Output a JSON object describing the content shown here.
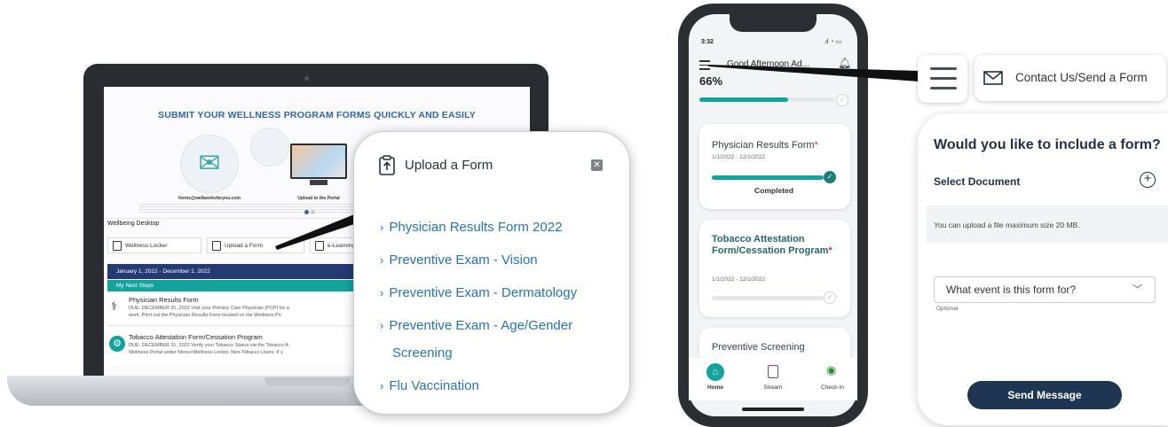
{
  "laptop": {
    "banner_title": "SUBMIT YOUR WELLNESS PROGRAM FORMS QUICKLY AND EASILY",
    "email_label": "forms@wellworksforyou.com",
    "portal_label": "Upload to the Portal",
    "wellbeing_desktop": "Wellbeing Desktop",
    "tools": [
      {
        "label": "Wellness Locker"
      },
      {
        "label": "Upload a Form"
      },
      {
        "label": "e-Learning"
      }
    ],
    "date_range": "January 1, 2022 - December 1, 2022",
    "next_steps": "My Next Steps",
    "steps": [
      {
        "title": "Physician Results Form",
        "desc1": "DUE: DECEMBER 31, 2022 Visit your Primary Care Physician (PCP) for a",
        "desc2": "work. Print out the Physician Results Form located on the Wellness Po"
      },
      {
        "title": "Tobacco Attestation Form/Cessation Program",
        "desc1": "DUE: DECEMBER 31, 2022 Verify your Tobacco Status via the Tobacco A",
        "desc2": "Wellness Portal under Menu>Wellness Locker.  Non-Tobacco Users: If y"
      }
    ]
  },
  "upload_popup": {
    "title": "Upload a Form",
    "close": "✕",
    "links": [
      "Physician Results Form 2022",
      "Preventive Exam - Vision",
      "Preventive Exam - Dermatology",
      "Preventive Exam - Age/Gender",
      "Screening",
      "Flu Vaccination"
    ]
  },
  "phone": {
    "time": "3:32",
    "greeting": "Good Afternoon Ad...",
    "progress_text": "66%",
    "progress": 0.66,
    "cards": [
      {
        "title": "Physician Results Form",
        "dates": "1/1/2022 - 12/1/2022",
        "status": "Completed"
      },
      {
        "title": "Tobacco Attestation Form/Cessation Program",
        "dates": "1/1/2022 - 12/1/2022"
      },
      {
        "title": "Preventive Screening"
      }
    ],
    "nav": [
      "Home",
      "Stream",
      "Check-In"
    ]
  },
  "contact": {
    "label": "Contact Us/Send a Form"
  },
  "form_panel": {
    "title": "Would you like to include a form?",
    "select_document": "Select Document",
    "note": "You can upload a file maximum size 20 MB.",
    "dropdown_placeholder": "What event is this form for?",
    "optional": "Optional",
    "send_button": "Send Message"
  },
  "colors": {
    "teal": "#14a49b",
    "navy": "#233a72",
    "link_blue": "#2573b5",
    "button_navy": "#1f3652"
  }
}
